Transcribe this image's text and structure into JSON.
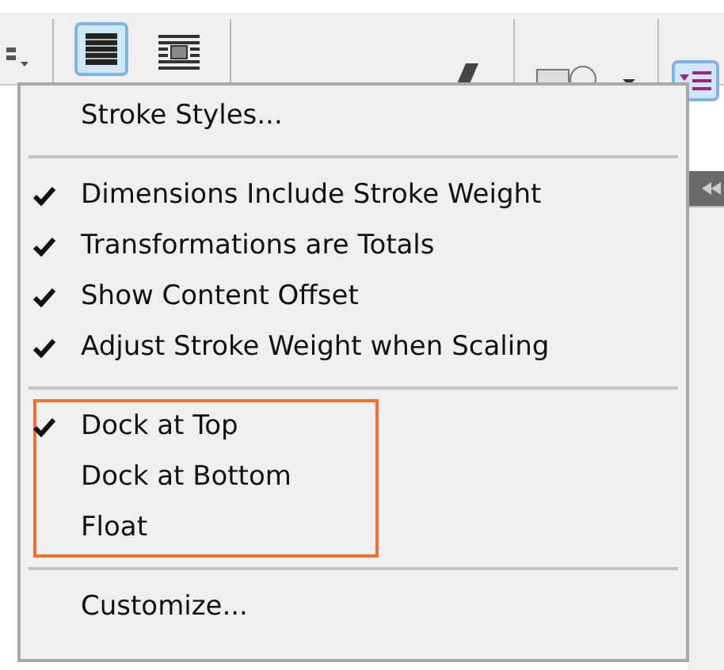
{
  "menu": {
    "groups": [
      {
        "highlighted": false,
        "items": [
          {
            "label": "Stroke Styles...",
            "checked": false
          }
        ]
      },
      {
        "highlighted": false,
        "items": [
          {
            "label": "Dimensions Include Stroke Weight",
            "checked": true
          },
          {
            "label": "Transformations are Totals",
            "checked": true
          },
          {
            "label": "Show Content Offset",
            "checked": true
          },
          {
            "label": "Adjust Stroke Weight when Scaling",
            "checked": true
          }
        ]
      },
      {
        "highlighted": true,
        "items": [
          {
            "label": "Dock at Top",
            "checked": true
          },
          {
            "label": "Dock at Bottom",
            "checked": false
          },
          {
            "label": "Float",
            "checked": false
          }
        ]
      },
      {
        "highlighted": false,
        "items": [
          {
            "label": "Customize...",
            "checked": false
          }
        ]
      }
    ]
  }
}
